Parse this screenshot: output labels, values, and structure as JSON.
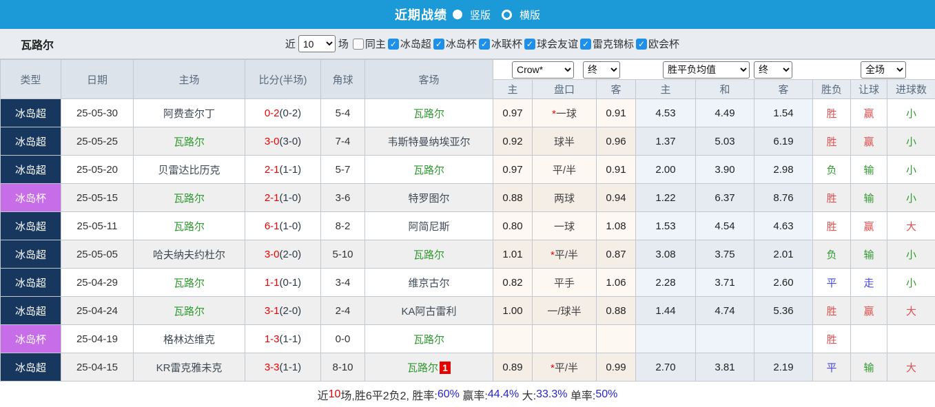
{
  "title_bar": {
    "title": "近期战绩",
    "radios": [
      {
        "label": "竖版",
        "selected": true
      },
      {
        "label": "横版",
        "selected": false
      }
    ]
  },
  "filter_bar": {
    "team": "瓦路尔",
    "recent_prefix": "近",
    "recent_value": "10",
    "recent_suffix": "场",
    "same_home": {
      "label": "同主",
      "checked": false
    },
    "leagues": [
      {
        "label": "冰岛超",
        "checked": true
      },
      {
        "label": "冰岛杯",
        "checked": true
      },
      {
        "label": "冰联杯",
        "checked": true
      },
      {
        "label": "球会友谊",
        "checked": true
      },
      {
        "label": "雷克锦标",
        "checked": true
      },
      {
        "label": "欧会杯",
        "checked": true
      }
    ]
  },
  "controls": {
    "bookmaker": "Crow*",
    "time1": "终",
    "average": "胜平负均值",
    "time2": "终",
    "scope": "全场"
  },
  "table": {
    "headers_left": [
      "类型",
      "日期",
      "主场",
      "比分(半场)",
      "角球",
      "客场"
    ],
    "headers_sub": [
      "主",
      "盘口",
      "客",
      "主",
      "和",
      "客",
      "胜负",
      "让球",
      "进球数"
    ],
    "rows": [
      {
        "type": "冰岛超",
        "cup": false,
        "date": "25-05-30",
        "home": "阿费查尔丁",
        "home_team": false,
        "score": "0-2",
        "half": "(0-2)",
        "corner": "5-4",
        "away": "瓦路尔",
        "away_team": true,
        "badge": "",
        "odds_home": "0.97",
        "star": true,
        "handicap": "一球",
        "odds_away": "0.91",
        "avg_home": "4.53",
        "avg_draw": "4.49",
        "avg_away": "1.54",
        "result": "胜",
        "result_color": "red",
        "hcp_result": "赢",
        "hcp_color": "red",
        "goal_result": "小",
        "goal_color": "green"
      },
      {
        "type": "冰岛超",
        "cup": false,
        "date": "25-05-25",
        "home": "瓦路尔",
        "home_team": true,
        "score": "3-0",
        "half": "(3-0)",
        "corner": "7-4",
        "away": "韦斯特曼纳埃亚尔",
        "away_team": false,
        "badge": "",
        "odds_home": "0.92",
        "star": false,
        "handicap": "球半",
        "odds_away": "0.96",
        "avg_home": "1.37",
        "avg_draw": "5.03",
        "avg_away": "6.19",
        "result": "胜",
        "result_color": "red",
        "hcp_result": "赢",
        "hcp_color": "red",
        "goal_result": "小",
        "goal_color": "green"
      },
      {
        "type": "冰岛超",
        "cup": false,
        "date": "25-05-20",
        "home": "贝雷达比历克",
        "home_team": false,
        "score": "2-1",
        "half": "(1-1)",
        "corner": "5-7",
        "away": "瓦路尔",
        "away_team": true,
        "badge": "",
        "odds_home": "0.97",
        "star": false,
        "handicap": "平/半",
        "odds_away": "0.91",
        "avg_home": "2.00",
        "avg_draw": "3.90",
        "avg_away": "2.98",
        "result": "负",
        "result_color": "green",
        "hcp_result": "输",
        "hcp_color": "green",
        "goal_result": "小",
        "goal_color": "green"
      },
      {
        "type": "冰岛杯",
        "cup": true,
        "date": "25-05-15",
        "home": "瓦路尔",
        "home_team": true,
        "score": "2-1",
        "half": "(1-0)",
        "corner": "3-6",
        "away": "特罗图尔",
        "away_team": false,
        "badge": "",
        "odds_home": "0.88",
        "star": false,
        "handicap": "两球",
        "odds_away": "0.94",
        "avg_home": "1.22",
        "avg_draw": "6.37",
        "avg_away": "8.76",
        "result": "胜",
        "result_color": "red",
        "hcp_result": "输",
        "hcp_color": "green",
        "goal_result": "小",
        "goal_color": "green"
      },
      {
        "type": "冰岛超",
        "cup": false,
        "date": "25-05-11",
        "home": "瓦路尔",
        "home_team": true,
        "score": "6-1",
        "half": "(1-0)",
        "corner": "8-2",
        "away": "阿简尼斯",
        "away_team": false,
        "badge": "",
        "odds_home": "0.80",
        "star": false,
        "handicap": "一球",
        "odds_away": "1.08",
        "avg_home": "1.53",
        "avg_draw": "4.54",
        "avg_away": "4.63",
        "result": "胜",
        "result_color": "red",
        "hcp_result": "赢",
        "hcp_color": "red",
        "goal_result": "大",
        "goal_color": "red"
      },
      {
        "type": "冰岛超",
        "cup": false,
        "date": "25-05-05",
        "home": "哈夫纳夫约杜尔",
        "home_team": false,
        "score": "3-0",
        "half": "(2-0)",
        "corner": "5-10",
        "away": "瓦路尔",
        "away_team": true,
        "badge": "",
        "odds_home": "1.01",
        "star": true,
        "handicap": "平/半",
        "odds_away": "0.87",
        "avg_home": "3.08",
        "avg_draw": "3.75",
        "avg_away": "2.01",
        "result": "负",
        "result_color": "green",
        "hcp_result": "输",
        "hcp_color": "green",
        "goal_result": "小",
        "goal_color": "green"
      },
      {
        "type": "冰岛超",
        "cup": false,
        "date": "25-04-29",
        "home": "瓦路尔",
        "home_team": true,
        "score": "1-1",
        "half": "(0-1)",
        "corner": "3-4",
        "away": "维京古尔",
        "away_team": false,
        "badge": "",
        "odds_home": "0.82",
        "star": false,
        "handicap": "平手",
        "odds_away": "1.06",
        "avg_home": "2.28",
        "avg_draw": "3.71",
        "avg_away": "2.60",
        "result": "平",
        "result_color": "blue",
        "hcp_result": "走",
        "hcp_color": "blue",
        "goal_result": "小",
        "goal_color": "green"
      },
      {
        "type": "冰岛超",
        "cup": false,
        "date": "25-04-24",
        "home": "瓦路尔",
        "home_team": true,
        "score": "3-1",
        "half": "(2-0)",
        "corner": "2-4",
        "away": "KA阿古雷利",
        "away_team": false,
        "badge": "",
        "odds_home": "1.00",
        "star": false,
        "handicap": "一/球半",
        "odds_away": "0.88",
        "avg_home": "1.44",
        "avg_draw": "4.74",
        "avg_away": "5.36",
        "result": "胜",
        "result_color": "red",
        "hcp_result": "赢",
        "hcp_color": "red",
        "goal_result": "大",
        "goal_color": "red"
      },
      {
        "type": "冰岛杯",
        "cup": true,
        "date": "25-04-19",
        "home": "格林达维克",
        "home_team": false,
        "score": "1-3",
        "half": "(1-1)",
        "corner": "0-0",
        "away": "瓦路尔",
        "away_team": true,
        "badge": "",
        "odds_home": "",
        "star": false,
        "handicap": "",
        "odds_away": "",
        "avg_home": "",
        "avg_draw": "",
        "avg_away": "",
        "result": "胜",
        "result_color": "red",
        "hcp_result": "",
        "hcp_color": "red",
        "goal_result": "",
        "goal_color": "green"
      },
      {
        "type": "冰岛超",
        "cup": false,
        "date": "25-04-15",
        "home": "KR雷克雅未克",
        "home_team": false,
        "score": "3-3",
        "half": "(1-1)",
        "corner": "8-10",
        "away": "瓦路尔",
        "away_team": true,
        "badge": "1",
        "odds_home": "0.89",
        "star": true,
        "handicap": "平/半",
        "odds_away": "0.99",
        "avg_home": "2.70",
        "avg_draw": "3.81",
        "avg_away": "2.19",
        "result": "平",
        "result_color": "blue",
        "hcp_result": "输",
        "hcp_color": "green",
        "goal_result": "大",
        "goal_color": "red"
      }
    ]
  },
  "summary": {
    "segments": [
      {
        "text": "近",
        "color": "dark"
      },
      {
        "text": "10",
        "color": "red"
      },
      {
        "text": "场,胜6平2负2, 胜率:",
        "color": "dark"
      },
      {
        "text": "60%",
        "color": "blue"
      },
      {
        "text": " 赢率:",
        "color": "dark"
      },
      {
        "text": "44.4%",
        "color": "blue"
      },
      {
        "text": " 大:",
        "color": "dark"
      },
      {
        "text": "33.3%",
        "color": "blue"
      },
      {
        "text": " 单率:",
        "color": "dark"
      },
      {
        "text": "50%",
        "color": "blue"
      }
    ]
  },
  "colors": {
    "header_blue": "#1b9ad7",
    "league_badge_navy": "#17375e",
    "cup_badge_purple": "#c76de8",
    "win_red": "#e25050",
    "lose_green": "#2f9a2f",
    "draw_blue": "#4848dc",
    "score_red": "#f00000",
    "asia_tint": "#fdf8f1",
    "avg_tint": "#eef4f9"
  }
}
